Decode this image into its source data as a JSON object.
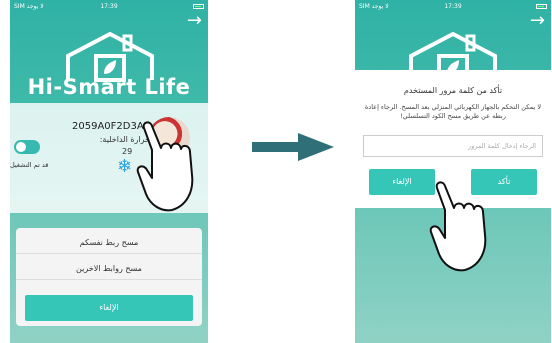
{
  "status": {
    "carrier": "SIM لا يوجد",
    "time": "17:39"
  },
  "brand": "Hi-Smart Life",
  "phone1": {
    "device_id": "2059A0F2D3AE",
    "temp_label": "حرارة الداخلية:",
    "temp_value": "29",
    "toggle_label": "قد تم التشغيل",
    "sheet": {
      "items": [
        "مسح ربط نفسكم",
        "مسح روابط الاخرين"
      ],
      "cancel": "الإلغاء"
    }
  },
  "phone2": {
    "dialog": {
      "title": "تأكد من كلمة مرور المستخدم",
      "message": "لا يمكن التحكم بالجهاز الكهربائي المنزلي بعد المسح. الرجاء إعادة ربطه عن طريق مسح الكود التسلسلي!",
      "input_placeholder": "الرجاء إدخال كلمة المرور",
      "cancel": "الإلغاء",
      "confirm": "تأكد"
    }
  },
  "colors": {
    "accent": "#35c6b8",
    "arrow": "#2f6f78"
  }
}
